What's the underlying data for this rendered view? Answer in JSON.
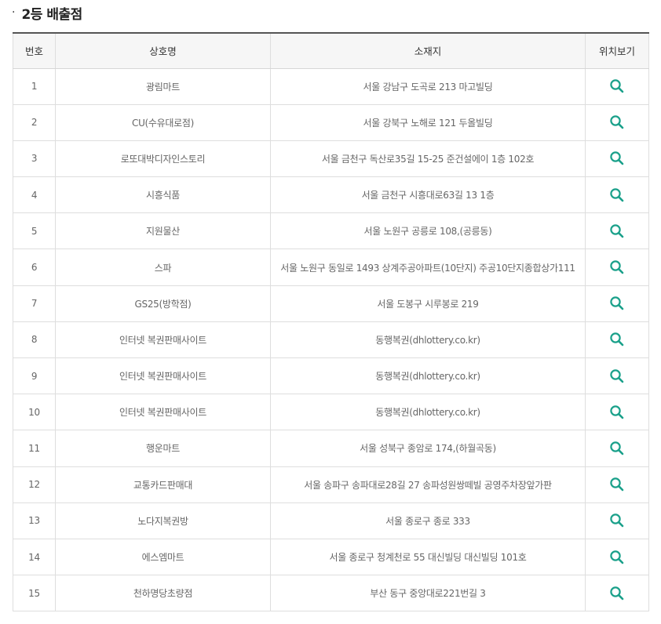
{
  "section": {
    "bullet": "·",
    "title": "2등 배출점"
  },
  "table": {
    "headers": [
      "번호",
      "상호명",
      "소재지",
      "위치보기"
    ],
    "rows": [
      {
        "no": "1",
        "name": "광림마트",
        "address": "서울 강남구 도곡로 213 마고빌딩"
      },
      {
        "no": "2",
        "name": "CU(수유대로점)",
        "address": "서울 강북구 노해로 121 두올빌딩"
      },
      {
        "no": "3",
        "name": "로또대박디자인스토리",
        "address": "서울 금천구 독산로35길 15-25 준건설에이 1층 102호"
      },
      {
        "no": "4",
        "name": "시흥식품",
        "address": "서울 금천구 시흥대로63길 13 1층"
      },
      {
        "no": "5",
        "name": "지원물산",
        "address": "서울 노원구 공릉로 108,(공릉동)"
      },
      {
        "no": "6",
        "name": "스파",
        "address": "서울 노원구 동일로 1493 상계주공아파트(10단지) 주공10단지종합상가111"
      },
      {
        "no": "7",
        "name": "GS25(방학점)",
        "address": "서울 도봉구 시루봉로 219"
      },
      {
        "no": "8",
        "name": "인터넷 복권판매사이트",
        "address": "동행복권(dhlottery.co.kr)"
      },
      {
        "no": "9",
        "name": "인터넷 복권판매사이트",
        "address": "동행복권(dhlottery.co.kr)"
      },
      {
        "no": "10",
        "name": "인터넷 복권판매사이트",
        "address": "동행복권(dhlottery.co.kr)"
      },
      {
        "no": "11",
        "name": "행운마트",
        "address": "서울 성북구 종암로 174,(하월곡동)"
      },
      {
        "no": "12",
        "name": "교통카드판매대",
        "address": "서울 송파구 송파대로28길 27 송파성원쌍떼빌 공영주차장앞가판"
      },
      {
        "no": "13",
        "name": "노다지복권방",
        "address": "서울 종로구 종로 333"
      },
      {
        "no": "14",
        "name": "에스엠마트",
        "address": "서울 종로구 청계천로 55 대신빌딩 대신빌딩 101호"
      },
      {
        "no": "15",
        "name": "천하명당초량점",
        "address": "부산 동구 중앙대로221번길 3"
      }
    ]
  },
  "icons": {
    "location": "search-icon"
  },
  "colors": {
    "icon": "#1aa08a",
    "header_bg": "#f6f6f6",
    "header_border": "#555555"
  }
}
